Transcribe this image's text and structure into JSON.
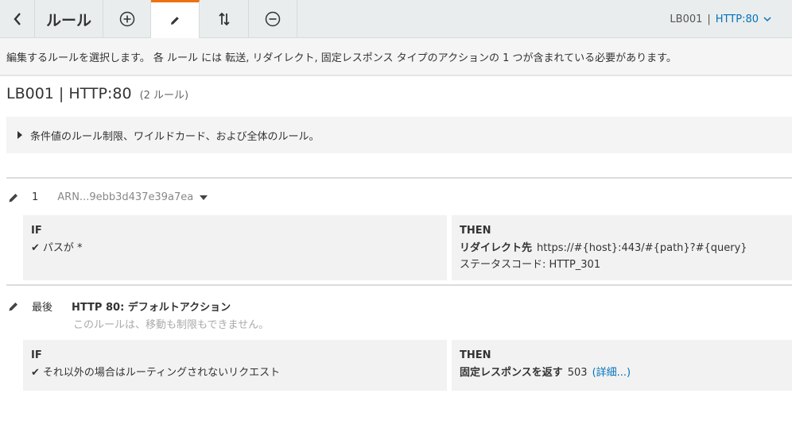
{
  "toolbar": {
    "title": "ルール",
    "lb_name": "LB001",
    "separator": "|",
    "listener": "HTTP:80"
  },
  "info": "編集するルールを選択します。 各 ルール には 転送, リダイレクト, 固定レスポンス タイプのアクションの 1 つが含まれている必要があります。",
  "page": {
    "title": "LB001 | HTTP:80",
    "rule_count": "(2 ルール)"
  },
  "expander_label": "条件値のルール制限、ワイルドカード、および全体のルール。",
  "rules": [
    {
      "index": "1",
      "arn": "ARN...9ebb3d437e39a7ea",
      "if_label": "IF",
      "condition": "パスが *",
      "then_label": "THEN",
      "action_type": "リダイレクト先",
      "action_value": "https://#{host}:443/#{path}?#{query}",
      "status_line": "ステータスコード: HTTP_301"
    },
    {
      "index": "最後",
      "name": "HTTP 80: デフォルトアクション",
      "note": "このルールは、移動も制限もできません。",
      "if_label": "IF",
      "condition": "それ以外の場合はルーティングされないリクエスト",
      "then_label": "THEN",
      "action_type": "固定レスポンスを返す",
      "action_value": "503",
      "details_link": "(詳細...)"
    }
  ],
  "colors": {
    "accent_tab": "#ec7211",
    "link": "#0073bb"
  },
  "icons": [
    "back-chevron-icon",
    "add-circle-icon",
    "pencil-icon",
    "reorder-arrows-icon",
    "remove-circle-icon",
    "chevron-down-icon",
    "caret-right-icon",
    "caret-down-icon",
    "check-icon"
  ]
}
